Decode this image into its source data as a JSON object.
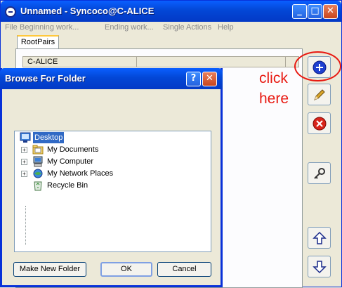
{
  "window": {
    "title": "Unnamed - Syncoco@C-ALICE",
    "minimize_glyph": "_",
    "maximize_glyph": "□",
    "close_glyph": "✕"
  },
  "menu": {
    "items": [
      "File",
      "Beginning work...",
      "Ending work...",
      "Single Actions",
      "Help"
    ]
  },
  "tabs": [
    {
      "label": "RootPairs"
    }
  ],
  "table": {
    "columns": [
      "C-ALICE",
      "",
      ""
    ]
  },
  "toolbar": {
    "icons": [
      "add-icon",
      "edit-pencil-icon",
      "delete-icon",
      "key-icon",
      "move-up-icon",
      "move-down-icon"
    ],
    "colors": {
      "add": "#1e3fd0",
      "delete": "#d8241a",
      "pencil": "#d9a62a"
    }
  },
  "annotation": {
    "line1": "click",
    "line2": "here",
    "color": "#e81a12"
  },
  "dialog": {
    "title": "Browse For Folder",
    "help_glyph": "?",
    "close_glyph": "✕",
    "tree": [
      {
        "label": "Desktop",
        "icon": "desktop-icon",
        "selected": true,
        "expandable": false
      },
      {
        "label": "My Documents",
        "icon": "folder-icon",
        "selected": false,
        "expandable": true
      },
      {
        "label": "My Computer",
        "icon": "computer-icon",
        "selected": false,
        "expandable": true
      },
      {
        "label": "My Network Places",
        "icon": "network-icon",
        "selected": false,
        "expandable": true
      },
      {
        "label": "Recycle Bin",
        "icon": "recycle-bin-icon",
        "selected": false,
        "expandable": false
      }
    ],
    "buttons": {
      "new_folder": "Make New Folder",
      "ok": "OK",
      "cancel": "Cancel"
    }
  }
}
